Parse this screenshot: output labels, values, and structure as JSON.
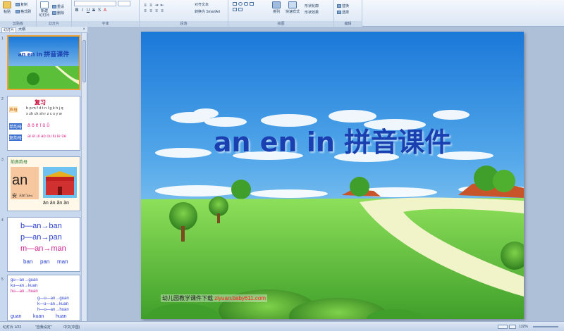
{
  "ribbon": {
    "groups": {
      "clipboard": "剪贴板",
      "slides": "幻灯片",
      "font": "字体",
      "paragraph": "段落",
      "drawing": "绘图",
      "editing": "编辑"
    },
    "paste_label": "粘贴",
    "copy_label": "复制",
    "format_painter_label": "格式刷",
    "new_slide_label": "新建\n幻灯片",
    "reset_label": "重设",
    "delete_label": "删除",
    "align_text_label": "对齐文本",
    "smartart_label": "转换为 SmartArt",
    "arrange_label": "排列",
    "quick_styles_label": "快速样式",
    "shape_fill_label": "形状轮廓",
    "shape_effects_label": "形状效果",
    "replace_label": "替换",
    "select_label": "选择"
  },
  "pane": {
    "tab_slides": "幻灯片",
    "tab_outline": "大纲",
    "close_glyph": "×",
    "numbers": [
      "1",
      "2",
      "3",
      "4",
      "5"
    ],
    "slide1_title": "an en in 拼音课件",
    "slide2": {
      "heading": "复习",
      "label_a": "声母",
      "line1": "b p m f d t n l g k h j q",
      "line2": "x zh ch sh r z c s y w",
      "label_b": "单韵母",
      "label_c": "复韵母",
      "row_b": "ā ō ē ī ū ǖ",
      "row_c": "ai ei ui ao ou iu ie üe"
    },
    "slide3": {
      "heading": "前鼻韵母",
      "big": "an",
      "char": "安",
      "small": "天安门(ān)",
      "tones": "ān án ǎn àn"
    },
    "slide4": {
      "line1": "b—an→ban",
      "line2": "p—an→pan",
      "line3": "m—an→man",
      "words": [
        "ban",
        "pan",
        "man"
      ]
    },
    "slide5": {
      "line1": "gu—an→guan",
      "line2": "ku—an→kuan",
      "line3": "hu—an→huan",
      "line4": "g—u—an→guan",
      "line5": "k—u—an→kuan",
      "line6": "h—u—an→huan",
      "words": [
        "guan",
        "kuan",
        "huan"
      ]
    }
  },
  "slide": {
    "title": "an en in 拼音课件",
    "footer_text": "幼儿园教学课件下载",
    "footer_url": "ziyuan.baby611.com"
  },
  "status": {
    "slide_count": "幻灯片 1/22",
    "theme": "\"自我设定\"",
    "language": "中文(中国)",
    "zoom": "132%"
  },
  "colors": {
    "sky_top": "#1a78d8",
    "sky_bottom": "#bfe4f6",
    "grass_light": "#7fd24a",
    "grass_dark": "#2f8f1f",
    "title": "#1a3fb0"
  }
}
